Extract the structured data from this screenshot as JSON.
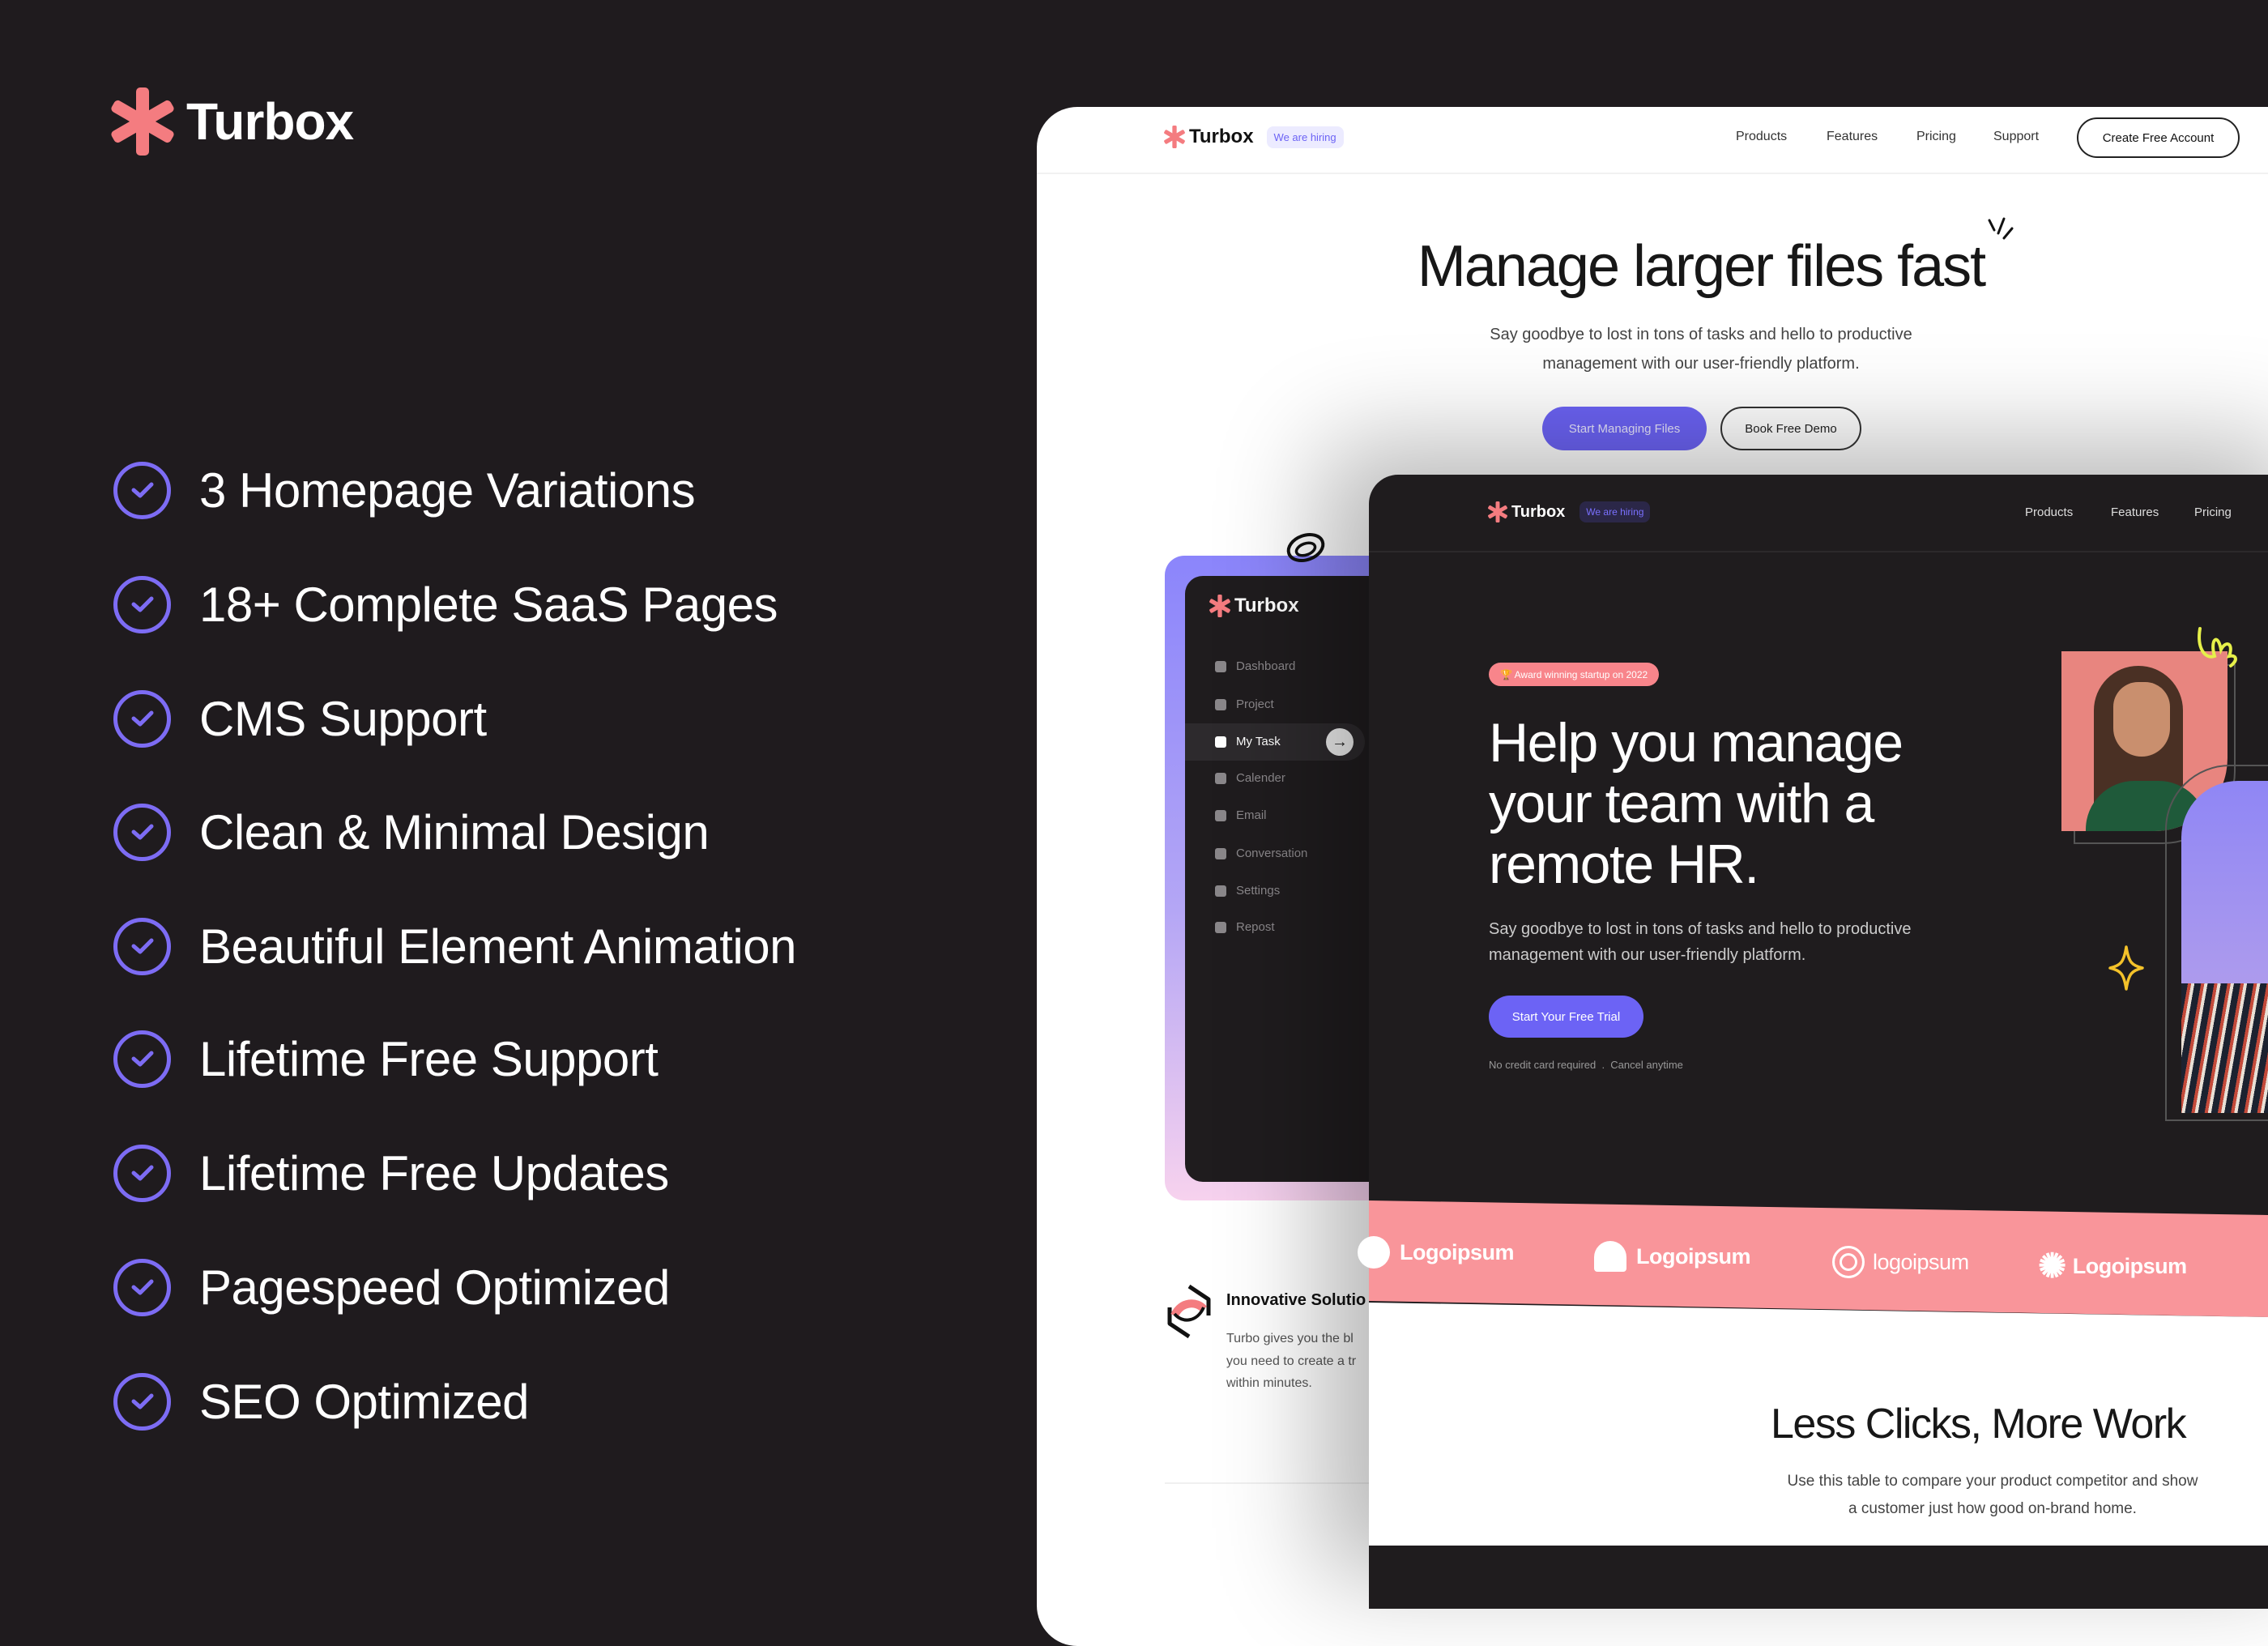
{
  "brand": {
    "name": "Turbox",
    "color": "#f47c80"
  },
  "features": [
    "3 Homepage Variations",
    "18+ Complete SaaS Pages",
    "CMS Support",
    "Clean & Minimal Design",
    "Beautiful Element Animation",
    "Lifetime Free Support",
    "Lifetime Free Updates",
    "Pagespeed Optimized",
    "SEO Optimized"
  ],
  "accent": "#6c63f5",
  "light_page": {
    "logo": "Turbox",
    "badge": "We are hiring",
    "nav": [
      "Products",
      "Features",
      "Pricing",
      "Support"
    ],
    "cta": "Create Free Account",
    "headline": "Manage larger files fast",
    "sub1": "Say goodbye to lost in tons of tasks and hello to productive",
    "sub2": "management with our user-friendly platform.",
    "btn_primary": "Start Managing Files",
    "btn_secondary": "Book Free Demo",
    "sidebar": {
      "logo": "Turbox",
      "items": [
        "Dashboard",
        "Project",
        "My Task",
        "Calender",
        "Email",
        "Conversation",
        "Settings",
        "Repost"
      ]
    },
    "feature_title": "Innovative Solutio",
    "feature_text": [
      "Turbo gives you the bl",
      "you need to create a tr",
      "within minutes."
    ]
  },
  "dark_page": {
    "logo": "Turbox",
    "badge": "We are hiring",
    "nav": [
      "Products",
      "Features",
      "Pricing"
    ],
    "award": "🏆 Award winning startup on 2022",
    "headline": [
      "Help you manage",
      "your team with a",
      "remote HR."
    ],
    "sub1": "Say goodbye to lost in tons of tasks and hello to productive",
    "sub2": "management with our user-friendly platform.",
    "btn": "Start Your Free Trial",
    "note": "No credit card required  .  Cancel anytime",
    "logos": [
      "Logoipsum",
      "Logoipsum",
      "logoipsum",
      "Logoipsum"
    ],
    "section_title": "Less Clicks, More Work",
    "section_sub1": "Use this table to compare your product competitor and show",
    "section_sub2": "a customer just how good on-brand home."
  }
}
